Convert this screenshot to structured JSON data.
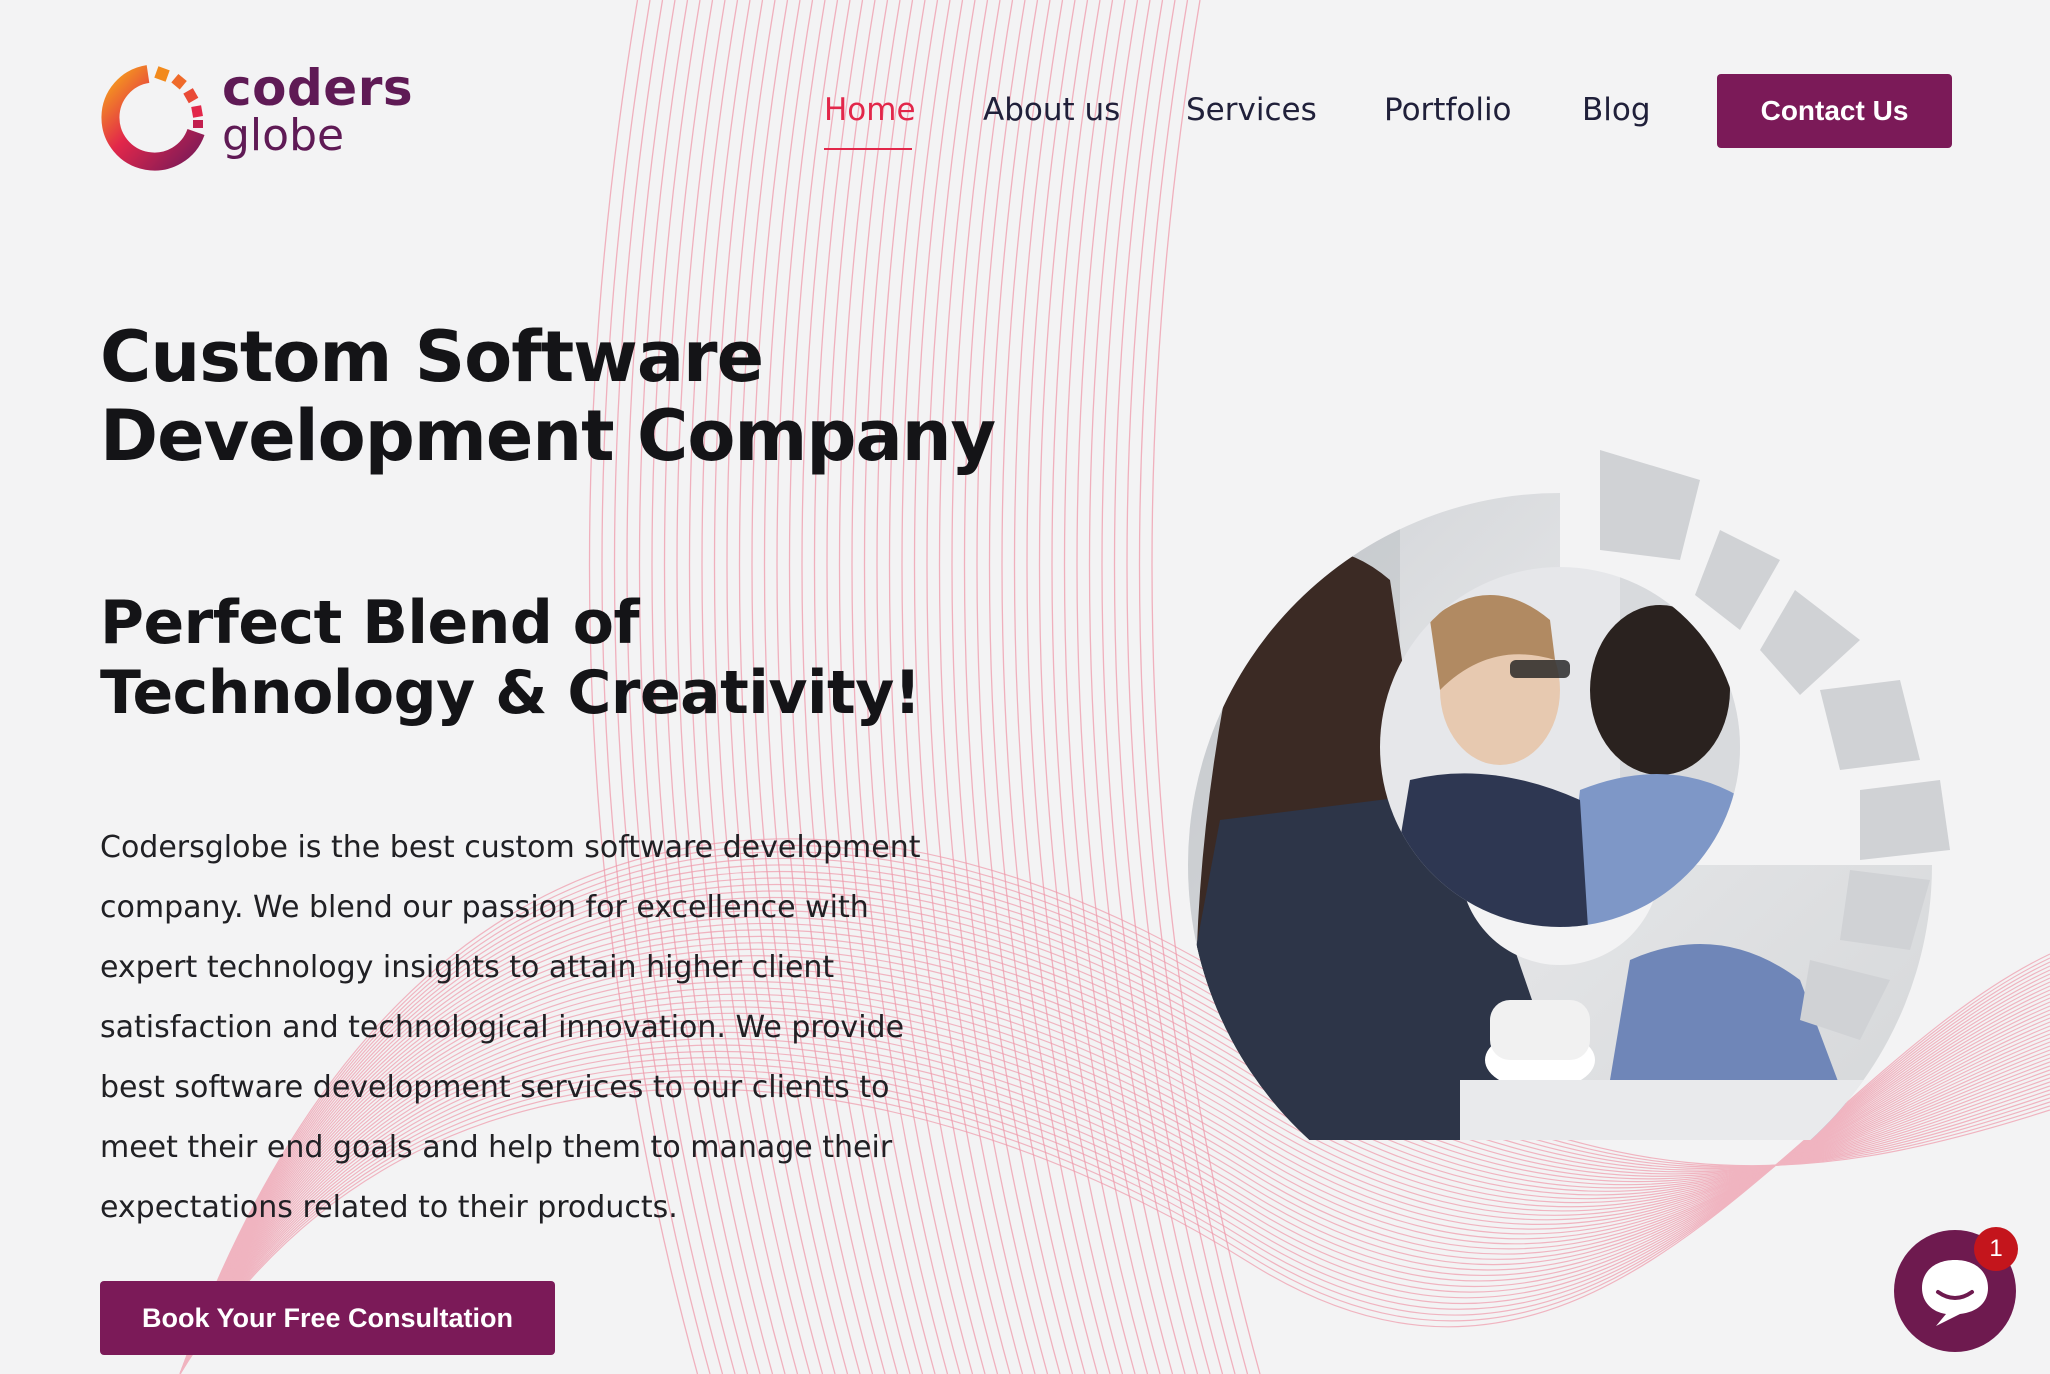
{
  "brand": {
    "name_line1": "coders",
    "name_line2": "globe",
    "primary_color": "#7b1a58",
    "accent_color": "#e2274a"
  },
  "nav": {
    "items": [
      {
        "label": "Home",
        "active": true
      },
      {
        "label": "About us",
        "active": false
      },
      {
        "label": "Services",
        "active": false
      },
      {
        "label": "Portfolio",
        "active": false
      },
      {
        "label": "Blog",
        "active": false
      }
    ],
    "contact_label": "Contact Us"
  },
  "hero": {
    "title_line1": "Custom Software",
    "title_line2": "Development Company",
    "subtitle_line1": "Perfect Blend of",
    "subtitle_line2": "Technology & Creativity!",
    "description_lines": [
      "Codersglobe is the best custom software development",
      "company. We blend our passion for excellence with",
      "expert technology insights to attain higher client",
      "satisfaction and technological innovation. We provide",
      "best software development services to our clients to",
      "meet their end goals and help them to manage their",
      "expectations related to their products."
    ],
    "cta_label": "Book Your Free Consultation",
    "image_icon": "team-working-photo"
  },
  "chat": {
    "icon": "chat-bubble-icon",
    "badge_count": "1"
  }
}
